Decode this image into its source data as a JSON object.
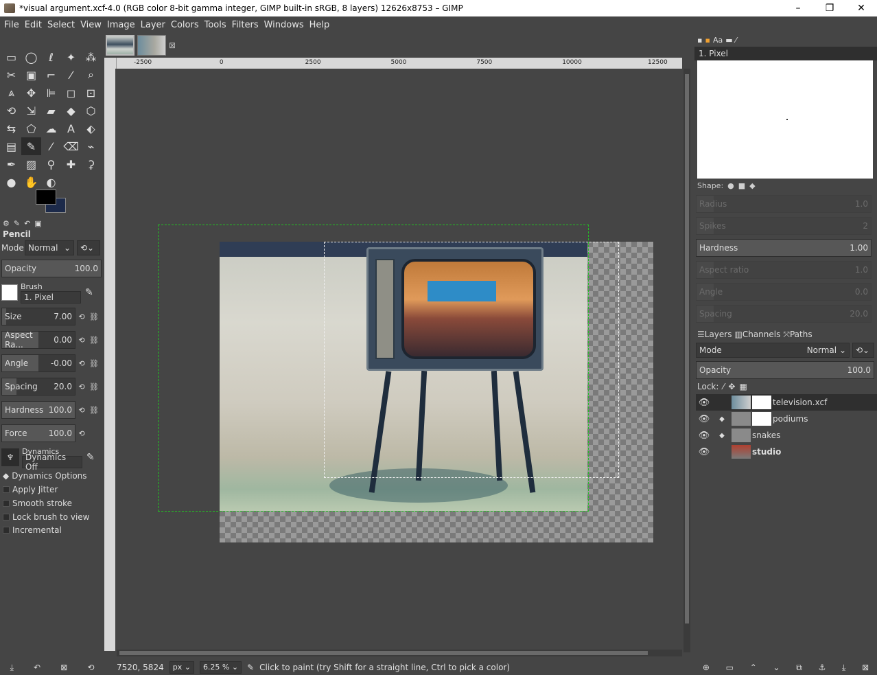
{
  "window": {
    "title": "*visual argument.xcf-4.0 (RGB color 8-bit gamma integer, GIMP built-in sRGB, 8 layers) 12626x8753 – GIMP",
    "minimize": "–",
    "restore": "❐",
    "close": "✕"
  },
  "menu": [
    "File",
    "Edit",
    "Select",
    "View",
    "Image",
    "Layer",
    "Colors",
    "Tools",
    "Filters",
    "Windows",
    "Help"
  ],
  "tools": [
    {
      "name": "rect-select-icon",
      "glyph": "▭"
    },
    {
      "name": "ellipse-select-icon",
      "glyph": "◯"
    },
    {
      "name": "lasso-icon",
      "glyph": "ℓ"
    },
    {
      "name": "fuzzy-select-icon",
      "glyph": "✦"
    },
    {
      "name": "select-by-color-icon",
      "glyph": "⁂"
    },
    {
      "name": "scissors-icon",
      "glyph": "✂"
    },
    {
      "name": "foreground-select-icon",
      "glyph": "▣"
    },
    {
      "name": "crop-icon",
      "glyph": "⌐"
    },
    {
      "name": "color-picker-icon",
      "glyph": "⁄"
    },
    {
      "name": "zoom-icon",
      "glyph": "⌕"
    },
    {
      "name": "measure-icon",
      "glyph": "⩓"
    },
    {
      "name": "move-icon",
      "glyph": "✥"
    },
    {
      "name": "align-icon",
      "glyph": "⊫"
    },
    {
      "name": "crop-box-icon",
      "glyph": "◻"
    },
    {
      "name": "unified-transform-icon",
      "glyph": "⊡"
    },
    {
      "name": "rotate-icon",
      "glyph": "⟲"
    },
    {
      "name": "scale-icon",
      "glyph": "⇲"
    },
    {
      "name": "shear-icon",
      "glyph": "▰"
    },
    {
      "name": "flip-icon",
      "glyph": "◆"
    },
    {
      "name": "perspective-icon",
      "glyph": "⬡"
    },
    {
      "name": "warp-icon",
      "glyph": "⇆"
    },
    {
      "name": "cage-icon",
      "glyph": "⬠"
    },
    {
      "name": "handle-transform-icon",
      "glyph": "☁"
    },
    {
      "name": "text-icon",
      "glyph": "A"
    },
    {
      "name": "bucket-fill-icon",
      "glyph": "⬖"
    },
    {
      "name": "gradient-icon",
      "glyph": "▤"
    },
    {
      "name": "pencil-icon",
      "glyph": "✎"
    },
    {
      "name": "paintbrush-icon",
      "glyph": "⁄"
    },
    {
      "name": "eraser-icon",
      "glyph": "⌫"
    },
    {
      "name": "airbrush-icon",
      "glyph": "⌁"
    },
    {
      "name": "ink-icon",
      "glyph": "✒"
    },
    {
      "name": "mypaint-icon",
      "glyph": "▨"
    },
    {
      "name": "clone-icon",
      "glyph": "⚲"
    },
    {
      "name": "heal-icon",
      "glyph": "✚"
    },
    {
      "name": "perspective-clone-icon",
      "glyph": "⚳"
    },
    {
      "name": "blur-icon",
      "glyph": "●"
    },
    {
      "name": "smudge-icon",
      "glyph": "✋"
    },
    {
      "name": "dodge-icon",
      "glyph": "◐"
    }
  ],
  "tool_options": {
    "title": "Pencil",
    "mode_label": "Mode",
    "mode_value": "Normal",
    "opacity_label": "Opacity",
    "opacity_value": "100.0",
    "brush_label": "Brush",
    "brush_value": "1. Pixel",
    "size_label": "Size",
    "size_value": "7.00",
    "aspect_label": "Aspect Ra...",
    "aspect_value": "0.00",
    "angle_label": "Angle",
    "angle_value": "-0.00",
    "spacing_label": "Spacing",
    "spacing_value": "20.0",
    "hardness_label": "Hardness",
    "hardness_value": "100.0",
    "force_label": "Force",
    "force_value": "100.0",
    "dynamics_label": "Dynamics",
    "dynamics_value": "Dynamics Off",
    "dynamics_options": "Dynamics Options",
    "checks": [
      "Apply Jitter",
      "Smooth stroke",
      "Lock brush to view",
      "Incremental"
    ]
  },
  "colors": {
    "foreground": "#000000",
    "background": "#1c2a4a"
  },
  "ruler_h_ticks": [
    {
      "label": "-2500"
    },
    {
      "label": "0"
    },
    {
      "label": "2500"
    },
    {
      "label": "5000"
    },
    {
      "label": "7500"
    },
    {
      "label": "10000"
    },
    {
      "label": "12500"
    }
  ],
  "status": {
    "coords": "7520, 5824",
    "unit": "px",
    "zoom": "6.25 %",
    "message": "Click to paint (try Shift for a straight line, Ctrl to pick a color)"
  },
  "brushes_dock": {
    "brush_name": "1. Pixel",
    "shape_label": "Shape:",
    "sliders": [
      {
        "label": "Radius",
        "value": "1.0",
        "dim": true
      },
      {
        "label": "Spikes",
        "value": "2",
        "dim": true
      },
      {
        "label": "Hardness",
        "value": "1.00",
        "dim": false
      },
      {
        "label": "Aspect ratio",
        "value": "1.0",
        "dim": true
      },
      {
        "label": "Angle",
        "value": "0.0",
        "dim": true
      },
      {
        "label": "Spacing",
        "value": "20.0",
        "dim": true
      }
    ]
  },
  "layers_dock": {
    "tabs": [
      "Layers",
      "Channels",
      "Paths"
    ],
    "mode_label": "Mode",
    "mode_value": "Normal",
    "opacity_label": "Opacity",
    "opacity_value": "100.0",
    "lock_label": "Lock:",
    "layers": [
      {
        "name": "television.xcf",
        "bold": false,
        "selected": true,
        "chain": ""
      },
      {
        "name": "podiums",
        "bold": false,
        "selected": false,
        "chain": "◆"
      },
      {
        "name": "snakes",
        "bold": false,
        "selected": false,
        "chain": "◆"
      },
      {
        "name": "studio",
        "bold": true,
        "selected": false,
        "chain": ""
      }
    ]
  }
}
